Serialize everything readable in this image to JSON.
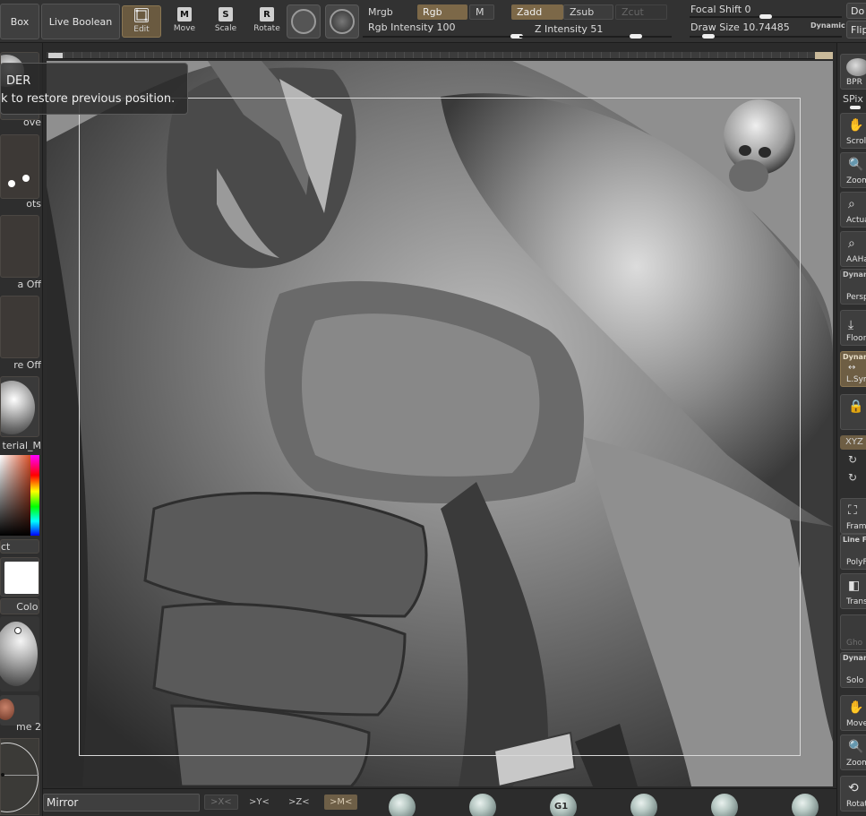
{
  "toolbar": {
    "box_label": "Box",
    "live_boolean_label": "Live Boolean",
    "edit_label": "Edit",
    "move_label": "Move",
    "move_key": "M",
    "scale_label": "Scale",
    "scale_key": "S",
    "rotate_label": "Rotate",
    "rotate_key": "R",
    "mrgb_label": "Mrgb",
    "rgb_label": "Rgb",
    "m_label": "M",
    "rgb_intensity_label": "Rgb Intensity",
    "rgb_intensity_value": "100",
    "zadd_label": "Zadd",
    "zsub_label": "Zsub",
    "zcut_label": "Zcut",
    "z_intensity_label": "Z Intensity",
    "z_intensity_value": "51",
    "focal_shift_label": "Focal Shift",
    "focal_shift_value": "0",
    "draw_size_label": "Draw Size",
    "draw_size_value": "10.74485",
    "dynamic_label": "Dynamic",
    "do_label": "Do",
    "flip_label": "Flip"
  },
  "tooltip": {
    "title": "DER",
    "message": "k to restore previous position."
  },
  "left_shelf": {
    "move_caption": "ove",
    "dots_caption": "ots",
    "alpha_caption": "a Off",
    "texture_caption": "re Off",
    "material_caption": "terial_M",
    "gradient_caption": "ct",
    "color_caption": "Color",
    "material2_caption": "me 2"
  },
  "right_shelf": {
    "bpr_label": "BPR",
    "spix_label": "SPix",
    "scroll_label": "Scrol",
    "zoom_label": "Zoom",
    "actual_label": "Actua",
    "aahalf_label": "AAHal",
    "dynamic_label": "Dynam",
    "persp_label": "Persp",
    "floor_label": "Floor",
    "dynamic2_label": "Dynam",
    "lsym_label": "L.Sym",
    "xyz_label": "XYZ",
    "frame_label": "Fram",
    "linefill_label": "Line F",
    "polyf_label": "PolyF",
    "transp_label": "Transp",
    "ghost_label": "Gho",
    "dynamic3_label": "Dynam",
    "solo_label": "Solo",
    "move_label": "Move",
    "zoom3d_label": "Zoom3",
    "rotate_label": "Rotat"
  },
  "bottom_bar": {
    "mirror_label": "Mirror",
    "x_axis": ">X<",
    "y_axis": ">Y<",
    "z_axis": ">Z<",
    "m_axis": ">M<",
    "brush_g1_label": "G1"
  },
  "colors": {
    "accent": "#7c6848",
    "viewport_bg": "#8f8f8f",
    "panel_bg": "#2e2e2e",
    "primary_color_swatch": "#ffffff"
  }
}
